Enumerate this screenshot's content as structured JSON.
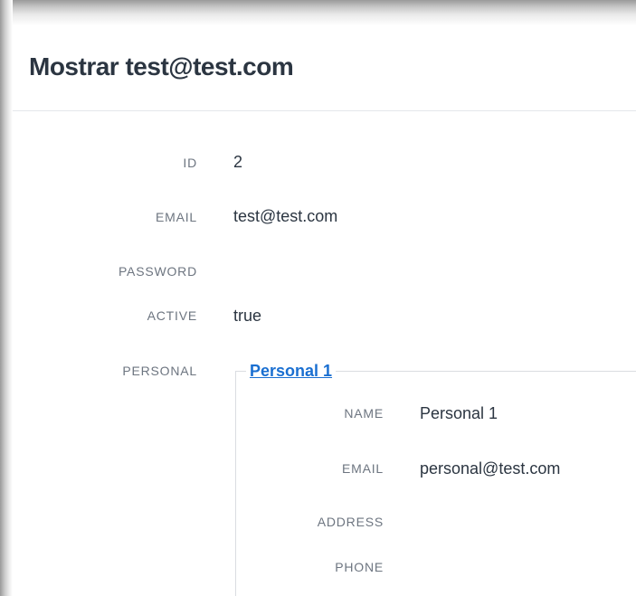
{
  "page": {
    "title": "Mostrar test@test.com"
  },
  "fields": [
    {
      "label": "ID",
      "value": "2"
    },
    {
      "label": "EMAIL",
      "value": "test@test.com"
    },
    {
      "label": "PASSWORD",
      "value": ""
    },
    {
      "label": "ACTIVE",
      "value": "true"
    },
    {
      "label": "PERSONAL",
      "value": ""
    }
  ],
  "personal": {
    "link_label": "Personal 1",
    "fields": [
      {
        "label": "NAME",
        "value": "Personal 1"
      },
      {
        "label": "EMAIL",
        "value": "personal@test.com"
      },
      {
        "label": "ADDRESS",
        "value": ""
      },
      {
        "label": "PHONE",
        "value": ""
      }
    ]
  },
  "colors": {
    "title": "#2b3541",
    "label": "#6d7580",
    "link": "#1a6fd1",
    "divider": "#e4e7eb"
  }
}
